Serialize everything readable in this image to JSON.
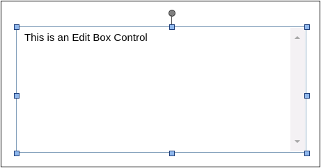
{
  "editbox": {
    "text": "This is an Edit Box Control"
  },
  "scrollbar": {
    "up_icon": "scroll-up-arrow",
    "down_icon": "scroll-down-arrow"
  },
  "selection": {
    "handle_color": "#8fb7ec",
    "handle_border_color": "#1f3f7a"
  }
}
